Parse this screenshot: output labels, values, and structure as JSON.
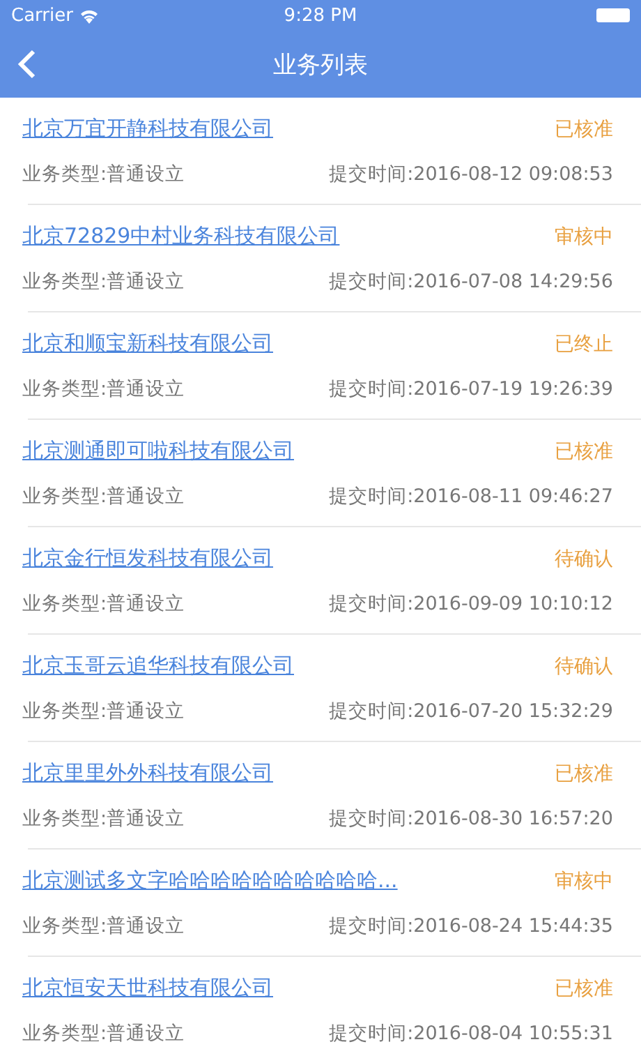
{
  "status_bar": {
    "carrier": "Carrier",
    "time": "9:28 PM"
  },
  "nav_bar": {
    "title": "业务列表"
  },
  "items": [
    {
      "company": "北京万宜开静科技有限公司",
      "status": "已核准",
      "type": "业务类型:普通设立",
      "submitted": "提交时间:2016-08-12 09:08:53"
    },
    {
      "company": "北京72829中村业务科技有限公司",
      "status": "审核中",
      "type": "业务类型:普通设立",
      "submitted": "提交时间:2016-07-08 14:29:56"
    },
    {
      "company": "北京和顺宝新科技有限公司",
      "status": "已终止",
      "type": "业务类型:普通设立",
      "submitted": "提交时间:2016-07-19 19:26:39"
    },
    {
      "company": "北京测通即可啦科技有限公司",
      "status": "已核准",
      "type": "业务类型:普通设立",
      "submitted": "提交时间:2016-08-11 09:46:27"
    },
    {
      "company": "北京金行恒发科技有限公司",
      "status": "待确认",
      "type": "业务类型:普通设立",
      "submitted": "提交时间:2016-09-09 10:10:12"
    },
    {
      "company": "北京玉哥云追华科技有限公司",
      "status": "待确认",
      "type": "业务类型:普通设立",
      "submitted": "提交时间:2016-07-20 15:32:29"
    },
    {
      "company": "北京里里外外科技有限公司",
      "status": "已核准",
      "type": "业务类型:普通设立",
      "submitted": "提交时间:2016-08-30 16:57:20"
    },
    {
      "company": "北京测试多文字哈哈哈哈哈哈哈哈哈哈...",
      "status": "审核中",
      "type": "业务类型:普通设立",
      "submitted": "提交时间:2016-08-24 15:44:35"
    },
    {
      "company": "北京恒安天世科技有限公司",
      "status": "已核准",
      "type": "业务类型:普通设立",
      "submitted": "提交时间:2016-08-04 10:55:31"
    }
  ]
}
